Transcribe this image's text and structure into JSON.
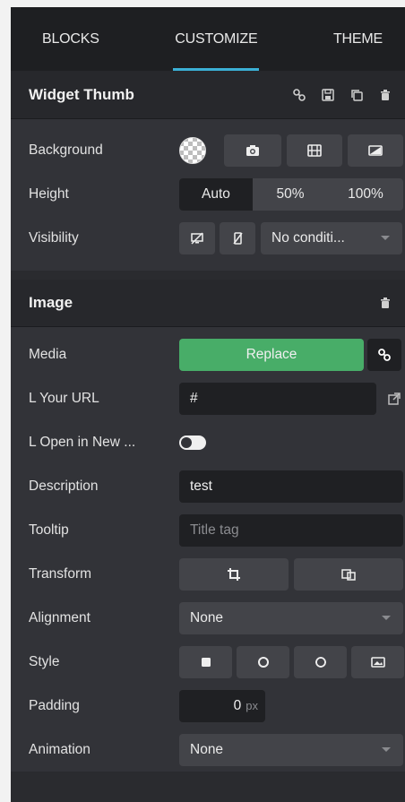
{
  "tabs": [
    {
      "label": "BLOCKS"
    },
    {
      "label": "CUSTOMIZE",
      "active": true
    },
    {
      "label": "THEME"
    }
  ],
  "widget": {
    "title": "Widget Thumb",
    "rows": {
      "background": {
        "label": "Background"
      },
      "height": {
        "label": "Height",
        "options": [
          "Auto",
          "50%",
          "100%"
        ],
        "selected": "Auto"
      },
      "visibility": {
        "label": "Visibility",
        "select": "No conditi..."
      }
    }
  },
  "image": {
    "title": "Image",
    "rows": {
      "media": {
        "label": "Media",
        "button": "Replace"
      },
      "url": {
        "label": "L  Your URL",
        "value": "#"
      },
      "newtab": {
        "label": "L  Open in New ..."
      },
      "description": {
        "label": "Description",
        "value": "test"
      },
      "tooltip": {
        "label": "Tooltip",
        "placeholder": "Title tag"
      },
      "transform": {
        "label": "Transform"
      },
      "alignment": {
        "label": "Alignment",
        "select": "None"
      },
      "style": {
        "label": "Style"
      },
      "padding": {
        "label": "Padding",
        "value": "0",
        "unit": "px"
      },
      "animation": {
        "label": "Animation",
        "select": "None"
      }
    }
  },
  "colors": {
    "accent": "#3bb0d6",
    "replace": "#48ad68"
  }
}
